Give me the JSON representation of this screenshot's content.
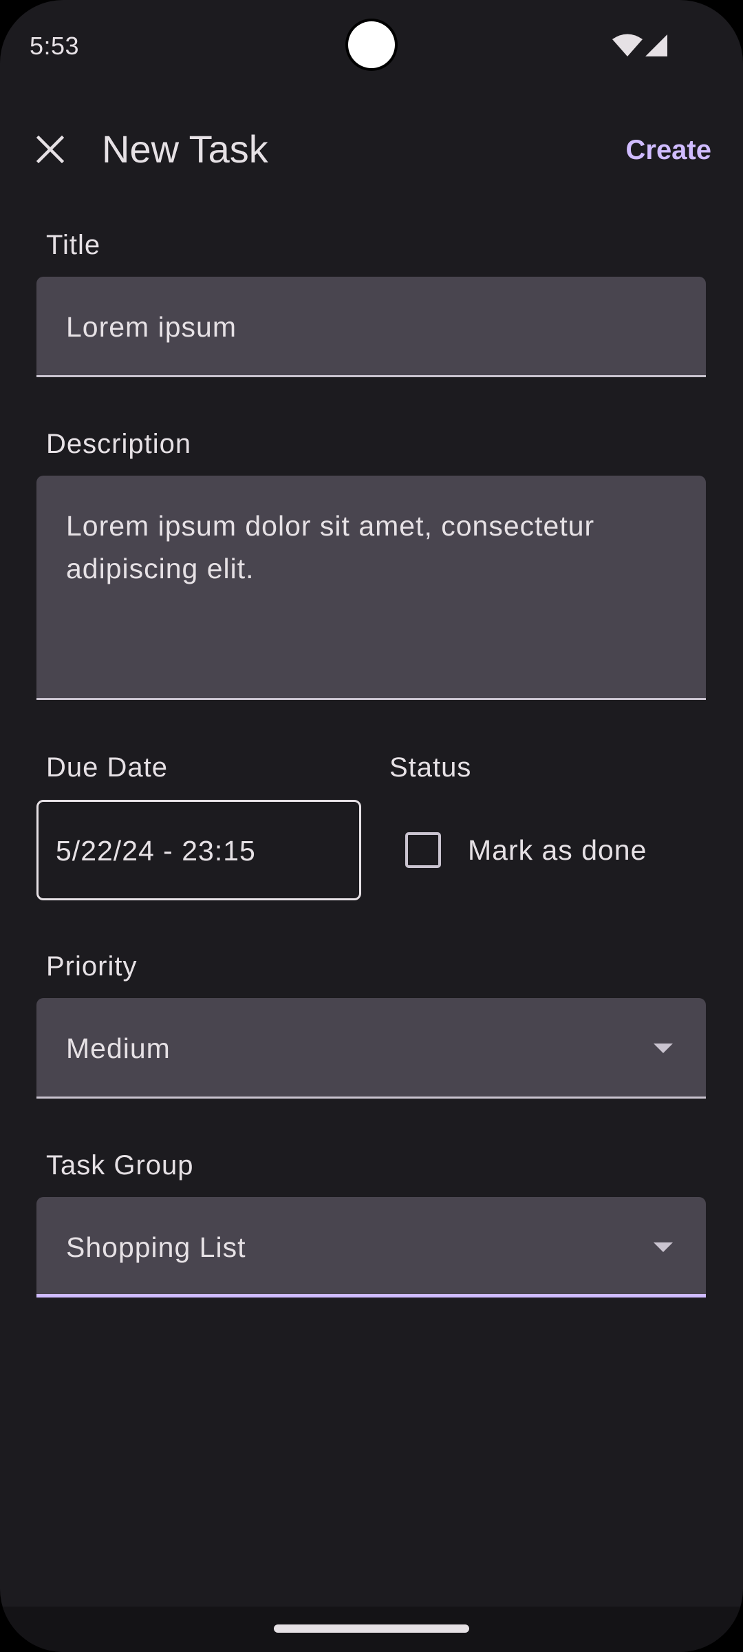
{
  "status_bar": {
    "time": "5:53",
    "icons": [
      "wifi-icon",
      "cell-signal-icon"
    ]
  },
  "app_bar": {
    "close_icon": "close-icon",
    "title": "New Task",
    "create_label": "Create"
  },
  "form": {
    "title": {
      "label": "Title",
      "value": "Lorem ipsum"
    },
    "description": {
      "label": "Description",
      "value_line1": "Lorem ipsum dolor sit amet, consectetur",
      "value_line2": "adipiscing elit."
    },
    "due_date": {
      "label": "Due Date",
      "value": "5/22/24 - 23:15"
    },
    "status": {
      "label": "Status",
      "checkbox_label": "Mark as done",
      "checked": false
    },
    "priority": {
      "label": "Priority",
      "value": "Medium"
    },
    "task_group": {
      "label": "Task Group",
      "value": "Shopping List"
    }
  },
  "colors": {
    "background": "#1c1b1f",
    "field_fill": "#49454f",
    "accent": "#d0bcff",
    "text": "#e6e1e5"
  }
}
